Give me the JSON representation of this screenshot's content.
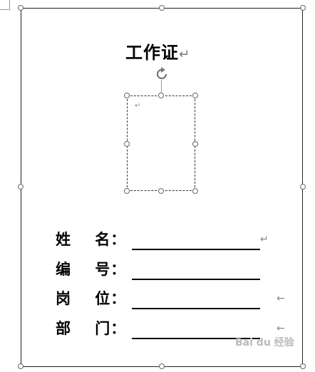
{
  "document": {
    "title": "工作证",
    "paragraph_mark": "↵",
    "fields": [
      {
        "label": "姓    名：",
        "mark": "↵"
      },
      {
        "label": "编    号：",
        "mark": ""
      },
      {
        "label": "岗    位：",
        "mark": "←"
      },
      {
        "label": "部    门：",
        "mark": "←"
      }
    ],
    "photo_mark": "↵"
  },
  "watermark": {
    "text": "Bai du 经验"
  },
  "colors": {
    "border": "#222222",
    "handle": "#666666",
    "text": "#000000",
    "marks": "#777777"
  },
  "icons": {
    "rotate": "rotate-handle-icon"
  }
}
